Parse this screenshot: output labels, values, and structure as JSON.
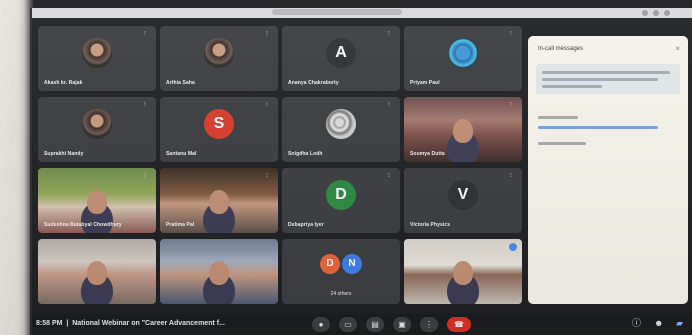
{
  "participants": [
    {
      "name": "Akash kr. Rajak",
      "type": "photo"
    },
    {
      "name": "Arthia Saha",
      "type": "photo"
    },
    {
      "name": "Ananya Chakraborty",
      "type": "letter",
      "letter": "A",
      "color": "#2f3033"
    },
    {
      "name": "Priyam Paul",
      "type": "logo"
    },
    {
      "name": "Suprakhi Nandy",
      "type": "photo"
    },
    {
      "name": "Santanu Mal",
      "type": "letter",
      "letter": "S",
      "color": "#d93a2b"
    },
    {
      "name": "Snigdha Lodh",
      "type": "texture"
    },
    {
      "name": "Soumya Dutta",
      "type": "video"
    },
    {
      "name": "Sudeshna Batabyal Chowdhury",
      "type": "video"
    },
    {
      "name": "Pratima Pal",
      "type": "video"
    },
    {
      "name": "Debapriya Iyer",
      "type": "letter",
      "letter": "D",
      "color": "#2c8a3f"
    },
    {
      "name": "Victoria Physics",
      "type": "letter",
      "letter": "V",
      "color": "#2f3033"
    },
    {
      "name": "",
      "type": "video"
    },
    {
      "name": "",
      "type": "video"
    },
    {
      "name": "24 others",
      "type": "others",
      "letters": [
        "D",
        "N"
      ],
      "colors": [
        "#e8643a",
        "#3f7ee8"
      ]
    },
    {
      "name": "",
      "type": "video"
    }
  ],
  "chat": {
    "title": "In-call messages",
    "close_icon": "close-icon"
  },
  "bottom": {
    "time": "8:58 PM",
    "separator": "|",
    "meeting_title": "National Webinar on \"Career Advancement f..."
  },
  "controls": [
    "mic-icon",
    "camera-icon",
    "captions-icon",
    "present-icon",
    "more-icon",
    "end-call-icon"
  ],
  "right_icons": [
    "info-icon",
    "people-icon",
    "chat-icon"
  ]
}
